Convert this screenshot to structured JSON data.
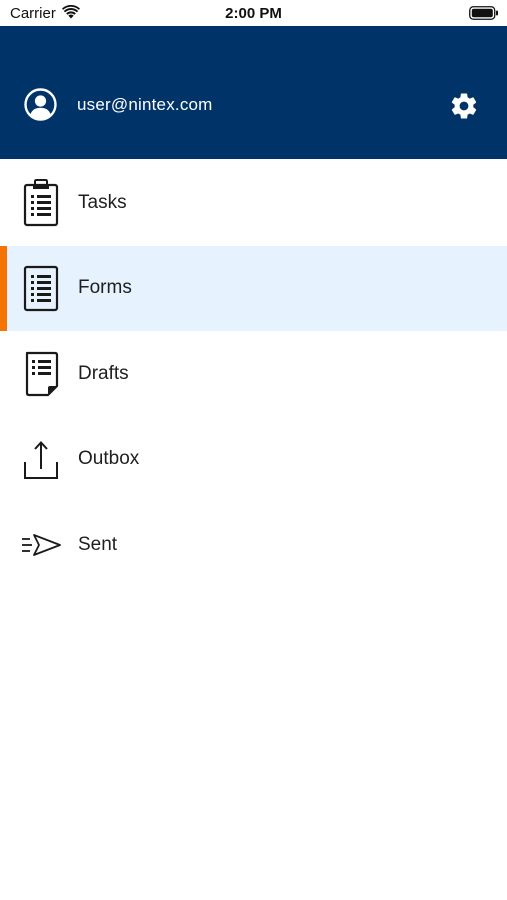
{
  "status_bar": {
    "carrier": "Carrier",
    "time": "2:00 PM",
    "icons": [
      "wifi-icon",
      "battery-icon"
    ]
  },
  "header": {
    "email": "user@nintex.com",
    "avatar_icon": "user-circle-icon",
    "settings_icon": "gear-icon",
    "background": "#003469"
  },
  "menu": {
    "items": [
      {
        "label": "Tasks",
        "icon": "clipboard-list-icon",
        "selected": false
      },
      {
        "label": "Forms",
        "icon": "form-list-icon",
        "selected": true
      },
      {
        "label": "Drafts",
        "icon": "draft-document-icon",
        "selected": false
      },
      {
        "label": "Outbox",
        "icon": "outbox-upload-icon",
        "selected": false
      },
      {
        "label": "Sent",
        "icon": "paper-plane-icon",
        "selected": false
      }
    ],
    "selected_background": "#e6f2fd",
    "selected_indicator": "#f57300"
  }
}
